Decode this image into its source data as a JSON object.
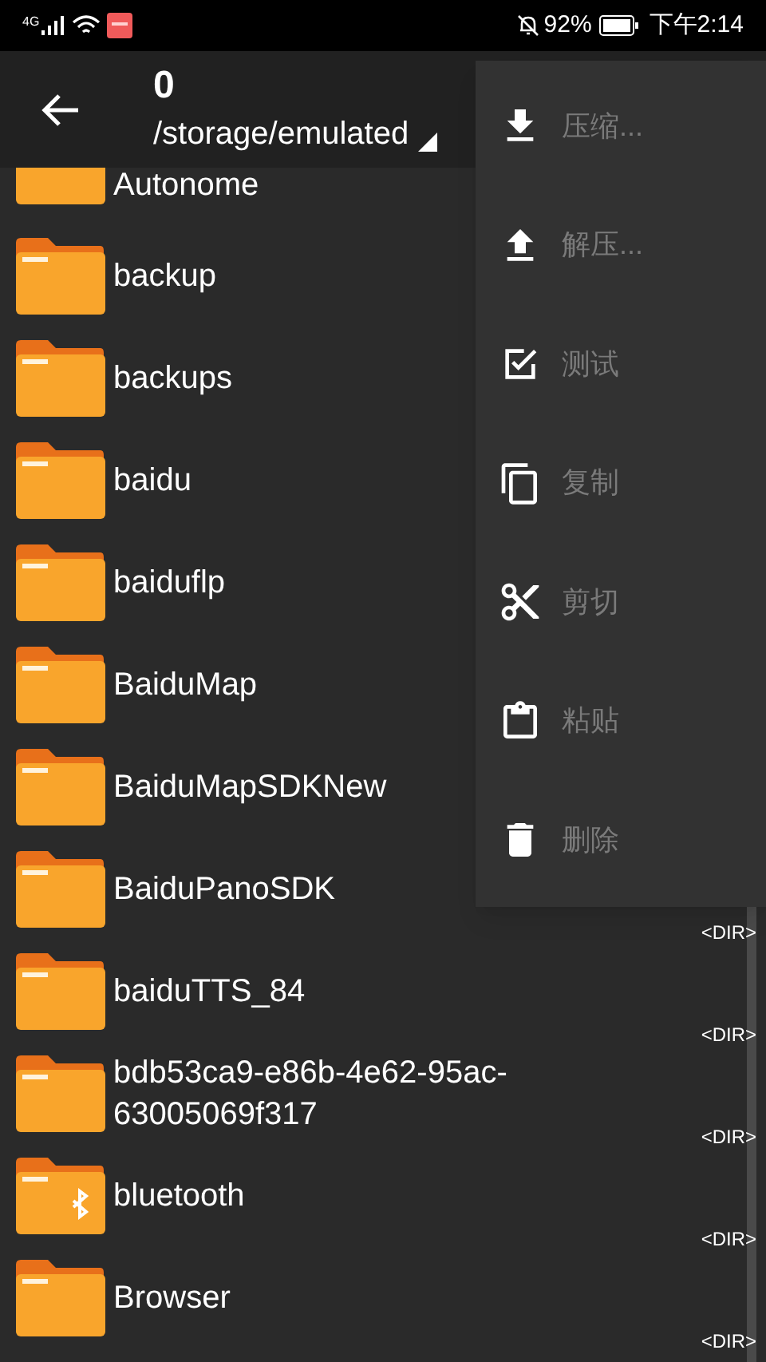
{
  "status_bar": {
    "network": "4G",
    "battery": "92%",
    "time": "下午2:14"
  },
  "toolbar": {
    "title": "0",
    "path": "/storage/emulated"
  },
  "files": [
    {
      "name": "Autonome",
      "kind": "folder",
      "partial": true
    },
    {
      "name": "backup",
      "kind": "folder"
    },
    {
      "name": "backups",
      "kind": "folder"
    },
    {
      "name": "baidu",
      "kind": "folder"
    },
    {
      "name": "baiduflp",
      "kind": "folder"
    },
    {
      "name": "BaiduMap",
      "kind": "folder"
    },
    {
      "name": "BaiduMapSDKNew",
      "kind": "folder"
    },
    {
      "name": "BaiduPanoSDK",
      "kind": "folder",
      "tag": "<DIR>"
    },
    {
      "name": "baiduTTS_84",
      "kind": "folder",
      "tag": "<DIR>"
    },
    {
      "name": "bdb53ca9-e86b-4e62-95ac-63005069f317",
      "kind": "folder",
      "tag": "<DIR>"
    },
    {
      "name": "bluetooth",
      "kind": "bluetooth-folder",
      "tag": "<DIR>"
    },
    {
      "name": "Browser",
      "kind": "folder",
      "tag": "<DIR>"
    }
  ],
  "menu": [
    {
      "label": "压缩...",
      "kind": "compress",
      "disabled": true
    },
    {
      "label": "解压...",
      "kind": "extract",
      "disabled": true
    },
    {
      "label": "测试",
      "kind": "test",
      "disabled": true
    },
    {
      "label": "复制",
      "kind": "copy",
      "disabled": true
    },
    {
      "label": "剪切",
      "kind": "cut",
      "disabled": true
    },
    {
      "label": "粘贴",
      "kind": "paste",
      "disabled": true
    },
    {
      "label": "删除",
      "kind": "delete",
      "disabled": true
    }
  ]
}
